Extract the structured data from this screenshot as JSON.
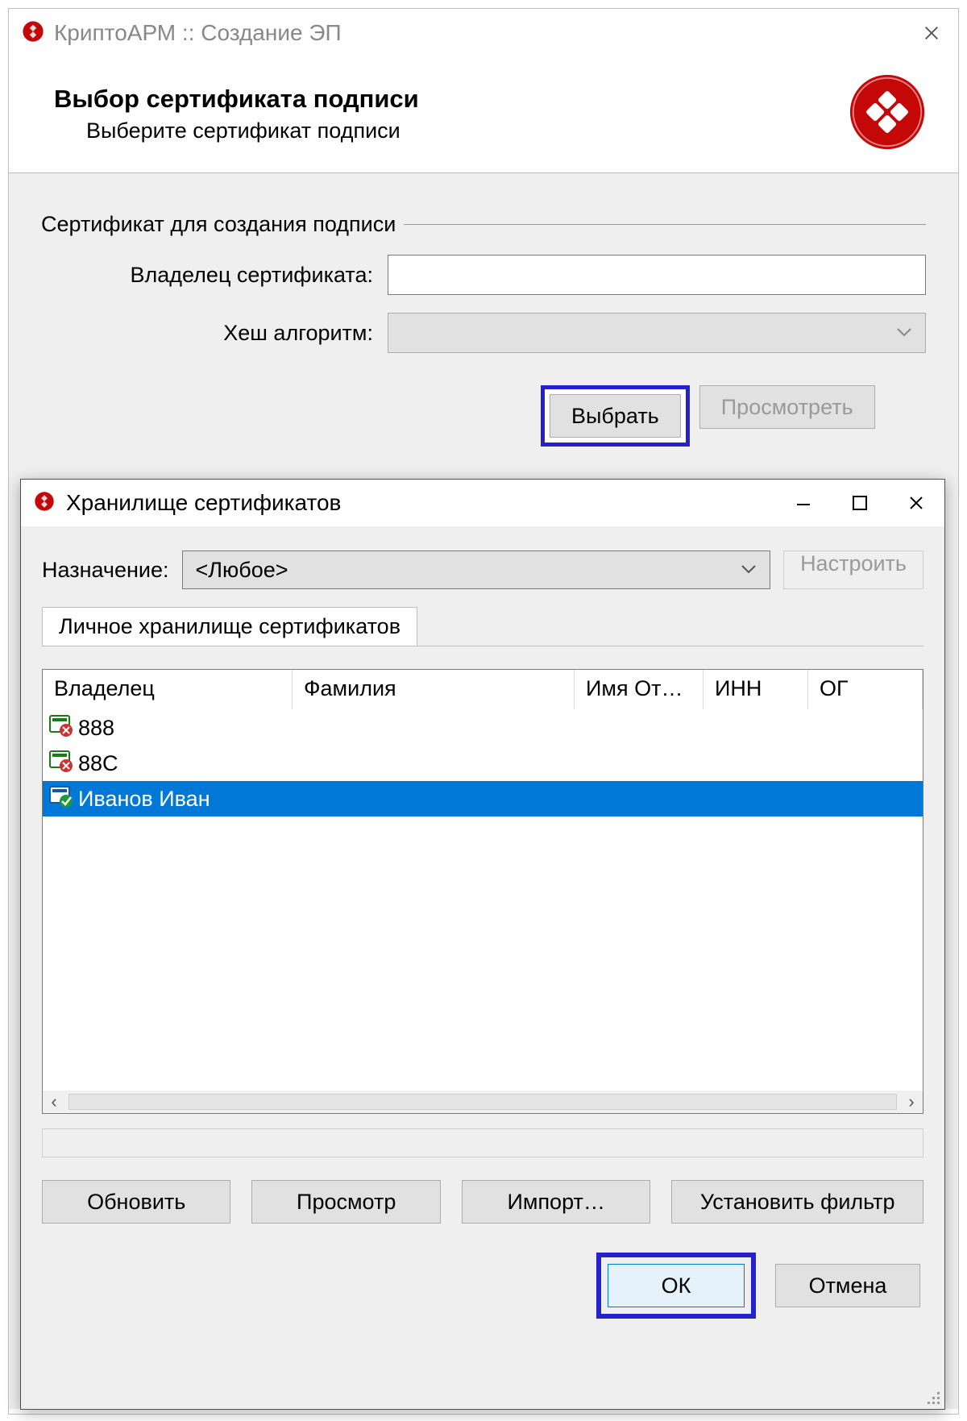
{
  "main": {
    "title": "КриптоАРМ :: Создание ЭП",
    "wizard_title": "Выбор сертификата подписи",
    "wizard_subtitle": "Выберите сертификат подписи",
    "fieldset_legend": "Сертификат для создания подписи",
    "owner_label": "Владелец сертификата:",
    "hash_label": "Хеш алгоритм:",
    "choose_btn": "Выбрать",
    "view_btn": "Просмотреть"
  },
  "modal": {
    "title": "Хранилище сертификатов",
    "purpose_label": "Назначение:",
    "purpose_value": "<Любое>",
    "configure_btn": "Настроить",
    "tab_personal": "Личное хранилище сертификатов",
    "columns": {
      "owner": "Владелец",
      "surname": "Фамилия",
      "name": "Имя От…",
      "inn": "ИНН",
      "ogr": "ОГ"
    },
    "rows": [
      {
        "owner": "888",
        "status": "invalid",
        "selected": false
      },
      {
        "owner": "88С",
        "status": "invalid",
        "selected": false
      },
      {
        "owner": "Иванов Иван",
        "status": "valid",
        "selected": true
      }
    ],
    "refresh_btn": "Обновить",
    "view_btn": "Просмотр",
    "import_btn": "Импорт…",
    "filter_btn": "Установить фильтр",
    "ok_btn": "ОК",
    "cancel_btn": "Отмена"
  }
}
